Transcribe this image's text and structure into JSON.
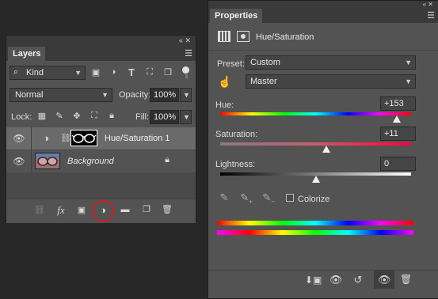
{
  "layers_panel": {
    "tab_label": "Layers",
    "header_controls": "« ✕",
    "filter": {
      "value": "Kind"
    },
    "blend_mode": {
      "value": "Normal"
    },
    "opacity": {
      "label": "Opacity:",
      "value": "100%"
    },
    "lock": {
      "label": "Lock:"
    },
    "fill": {
      "label": "Fill:",
      "value": "100%"
    },
    "layers": [
      {
        "name": "Hue/Saturation 1",
        "visible": true,
        "selected": true
      },
      {
        "name": "Background",
        "visible": true,
        "selected": false,
        "locked": true
      }
    ],
    "footer_icons": [
      "link-icon",
      "fx-icon",
      "mask-icon",
      "adjustment-icon",
      "folder-icon",
      "new-layer-icon",
      "trash-icon"
    ],
    "fx_label": "fx",
    "highlight_color": "#cc1f1f"
  },
  "properties_panel": {
    "tab_label": "Properties",
    "header_controls": "« ✕",
    "title": "Hue/Saturation",
    "preset": {
      "label": "Preset:",
      "value": "Custom"
    },
    "channel": {
      "value": "Master"
    },
    "hue": {
      "label": "Hue:",
      "value": "+153",
      "slider_fraction": 0.925
    },
    "saturation": {
      "label": "Saturation:",
      "value": "+11",
      "slider_fraction": 0.555
    },
    "lightness": {
      "label": "Lightness:",
      "value": "0",
      "slider_fraction": 0.5
    },
    "colorize": {
      "label": "Colorize",
      "checked": false
    },
    "footer_icons": [
      "clip-icon",
      "view-previous-icon",
      "reset-icon",
      "visibility-icon",
      "trash-icon"
    ]
  }
}
